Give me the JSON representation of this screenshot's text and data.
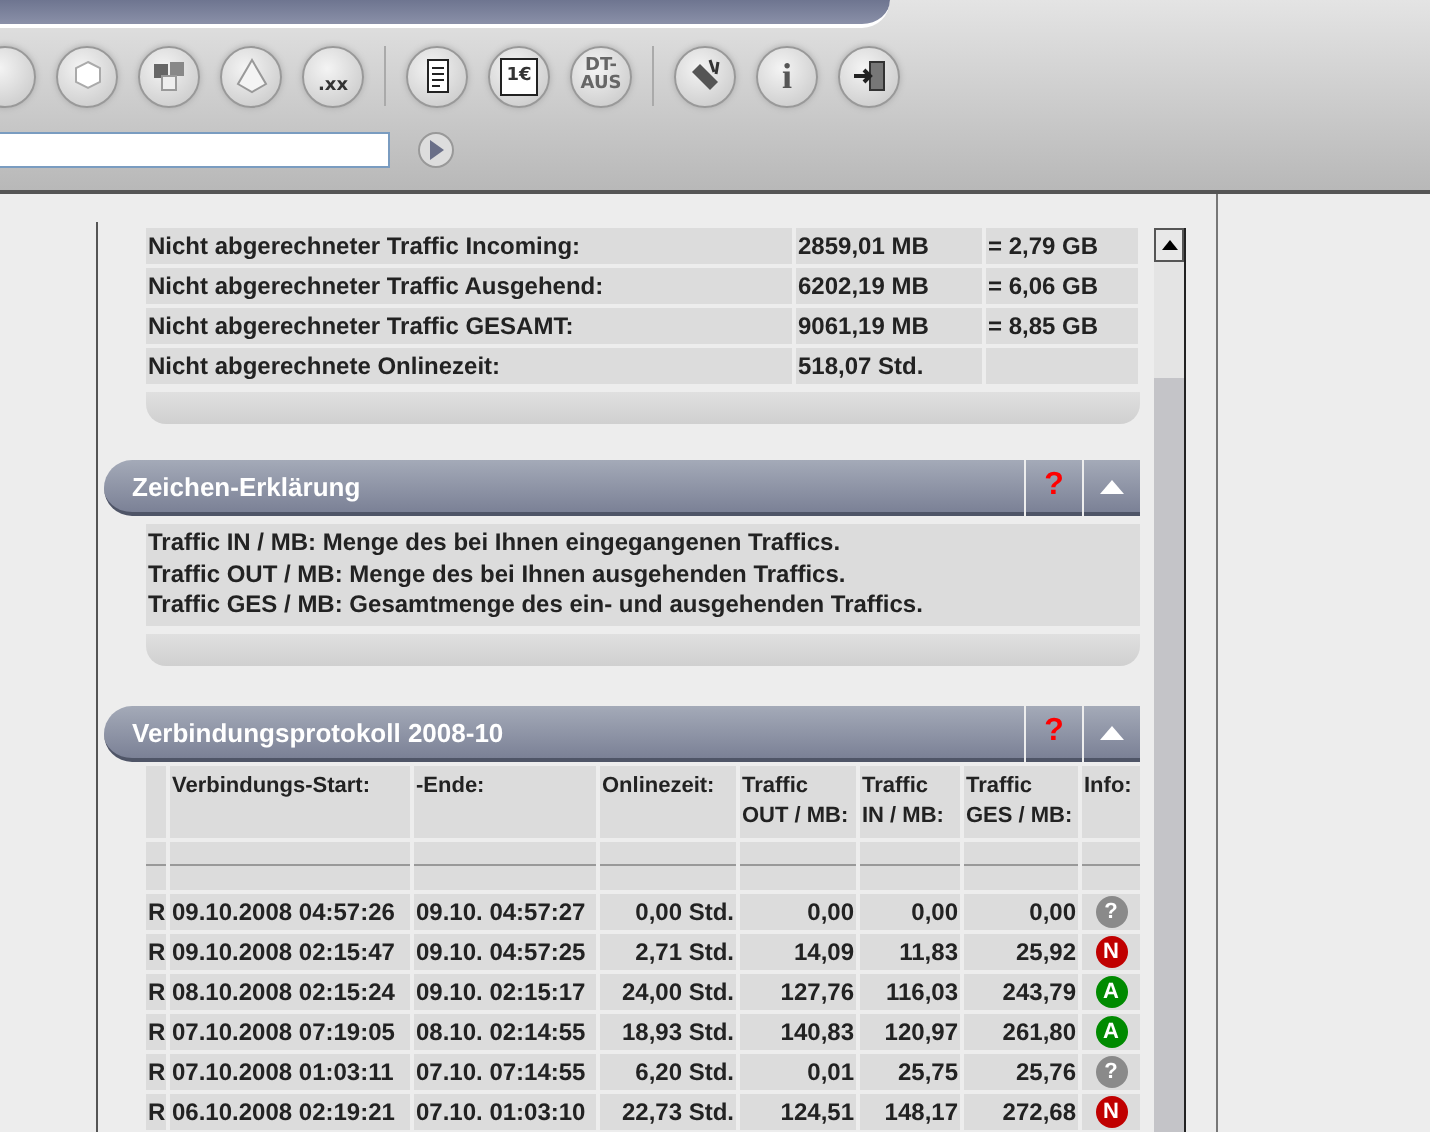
{
  "toolbar": {
    "buttons": [
      {
        "kind": "partial"
      },
      {
        "kind": "cube"
      },
      {
        "kind": "cubes"
      },
      {
        "kind": "pyramid"
      },
      {
        "kind": "crane",
        "label": ".xx"
      },
      {
        "kind": "separator"
      },
      {
        "kind": "document"
      },
      {
        "kind": "invoice",
        "label": "1€"
      },
      {
        "kind": "text",
        "label": "DT-AUS"
      },
      {
        "kind": "separator"
      },
      {
        "kind": "tools"
      },
      {
        "kind": "info",
        "label": "i"
      },
      {
        "kind": "exit"
      }
    ]
  },
  "summary": {
    "rows": [
      {
        "label": "Nicht abgerechneter Traffic Incoming:",
        "value": "2859,01 MB",
        "converted": "= 2,79 GB"
      },
      {
        "label": "Nicht abgerechneter Traffic Ausgehend:",
        "value": "6202,19 MB",
        "converted": "= 6,06 GB"
      },
      {
        "label": "Nicht abgerechneter Traffic GESAMT:",
        "value": "9061,19 MB",
        "converted": "= 8,85 GB"
      },
      {
        "label": "Nicht abgerechnete Onlinezeit:",
        "value": "518,07 Std."
      }
    ]
  },
  "legend": {
    "title": "Zeichen-Erklärung",
    "help": "?",
    "expanded": true,
    "lines": [
      "Traffic IN / MB: Menge des bei Ihnen eingegangenen Traffics.",
      "Traffic OUT / MB: Menge des bei Ihnen ausgehenden Traffics.",
      "Traffic GES / MB: Gesamtmenge des ein- und ausgehenden Traffics."
    ]
  },
  "log": {
    "title": "Verbindungsprotokoll 2008-10",
    "help": "?",
    "expanded": true,
    "columns": [
      "Verbindungs-Start:",
      "-Ende:",
      "Onlinezeit:",
      "Traffic\nOUT / MB:",
      "Traffic\nIN / MB:",
      "Traffic\nGES / MB:",
      "Info:"
    ],
    "rows": [
      {
        "type": "R",
        "start": "09.10.2008 04:57:26",
        "end": "09.10. 04:57:27",
        "time": "0,00 Std.",
        "out": "0,00",
        "in": "0,00",
        "total": "0,00",
        "info": "?",
        "color": "#8a8a8a"
      },
      {
        "type": "R",
        "start": "09.10.2008 02:15:47",
        "end": "09.10. 04:57:25",
        "time": "2,71 Std.",
        "out": "14,09",
        "in": "11,83",
        "total": "25,92",
        "info": "N",
        "color": "#c00000"
      },
      {
        "type": "R",
        "start": "08.10.2008 02:15:24",
        "end": "09.10. 02:15:17",
        "time": "24,00 Std.",
        "out": "127,76",
        "in": "116,03",
        "total": "243,79",
        "info": "A",
        "color": "#008a00"
      },
      {
        "type": "R",
        "start": "07.10.2008 07:19:05",
        "end": "08.10. 02:14:55",
        "time": "18,93 Std.",
        "out": "140,83",
        "in": "120,97",
        "total": "261,80",
        "info": "A",
        "color": "#008a00"
      },
      {
        "type": "R",
        "start": "07.10.2008 01:03:11",
        "end": "07.10. 07:14:55",
        "time": "6,20 Std.",
        "out": "0,01",
        "in": "25,75",
        "total": "25,76",
        "info": "?",
        "color": "#8a8a8a"
      },
      {
        "type": "R",
        "start": "06.10.2008 02:19:21",
        "end": "07.10. 01:03:10",
        "time": "22,73 Std.",
        "out": "124,51",
        "in": "148,17",
        "total": "272,68",
        "info": "N",
        "color": "#c00000"
      }
    ]
  }
}
